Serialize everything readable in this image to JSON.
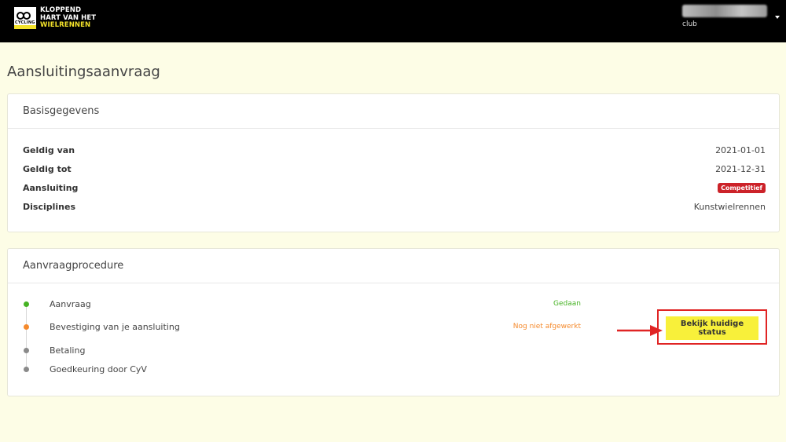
{
  "header": {
    "logo": {
      "line1": "KLOPPEND",
      "line2": "HART VAN HET",
      "line3": "WIELRENNEN",
      "mark_text": "CYCLING",
      "icon": "cycling-vlaanderen-logo"
    },
    "user": {
      "role": "club",
      "menu_icon": "caret-down-icon"
    }
  },
  "page": {
    "title": "Aansluitingsaanvraag"
  },
  "basisgegevens": {
    "title": "Basisgegevens",
    "rows": [
      {
        "label": "Geldig van",
        "value": "2021-01-01"
      },
      {
        "label": "Geldig tot",
        "value": "2021-12-31"
      },
      {
        "label": "Aansluiting",
        "value": "Competitief"
      },
      {
        "label": "Disciplines",
        "value": "Kunstwielrennen"
      }
    ]
  },
  "procedure": {
    "title": "Aanvraagprocedure",
    "steps": [
      {
        "name": "Aanvraag",
        "status": "Gedaan",
        "state": "done"
      },
      {
        "name": "Bevestiging van je aansluiting",
        "status": "Nog niet afgewerkt",
        "state": "pending"
      },
      {
        "name": "Betaling",
        "status": "",
        "state": "todo"
      },
      {
        "name": "Goedkeuring door CyV",
        "status": "",
        "state": "todo"
      }
    ],
    "action_button": "Bekijk huidige status"
  },
  "colors": {
    "accent_yellow": "#f8f03a",
    "done_green": "#46b324",
    "pending_orange": "#f58a2c",
    "badge_red": "#cc2229",
    "annotation_red": "#e02424"
  }
}
